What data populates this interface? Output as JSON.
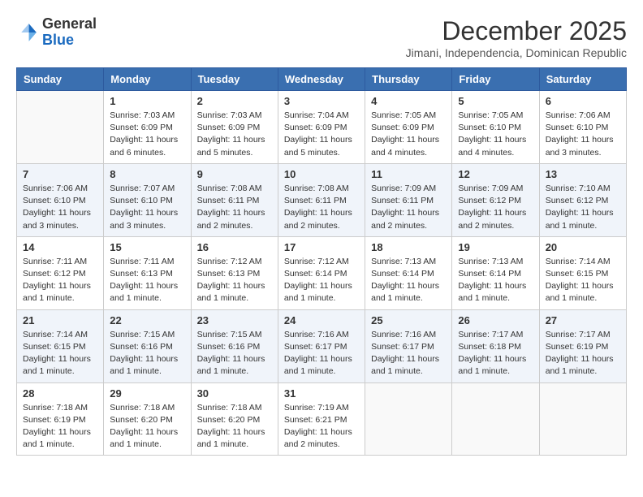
{
  "header": {
    "logo_line1": "General",
    "logo_line2": "Blue",
    "month_title": "December 2025",
    "subtitle": "Jimani, Independencia, Dominican Republic"
  },
  "weekdays": [
    "Sunday",
    "Monday",
    "Tuesday",
    "Wednesday",
    "Thursday",
    "Friday",
    "Saturday"
  ],
  "rows": [
    [
      {
        "day": "",
        "info": ""
      },
      {
        "day": "1",
        "info": "Sunrise: 7:03 AM\nSunset: 6:09 PM\nDaylight: 11 hours\nand 6 minutes."
      },
      {
        "day": "2",
        "info": "Sunrise: 7:03 AM\nSunset: 6:09 PM\nDaylight: 11 hours\nand 5 minutes."
      },
      {
        "day": "3",
        "info": "Sunrise: 7:04 AM\nSunset: 6:09 PM\nDaylight: 11 hours\nand 5 minutes."
      },
      {
        "day": "4",
        "info": "Sunrise: 7:05 AM\nSunset: 6:09 PM\nDaylight: 11 hours\nand 4 minutes."
      },
      {
        "day": "5",
        "info": "Sunrise: 7:05 AM\nSunset: 6:10 PM\nDaylight: 11 hours\nand 4 minutes."
      },
      {
        "day": "6",
        "info": "Sunrise: 7:06 AM\nSunset: 6:10 PM\nDaylight: 11 hours\nand 3 minutes."
      }
    ],
    [
      {
        "day": "7",
        "info": "Sunrise: 7:06 AM\nSunset: 6:10 PM\nDaylight: 11 hours\nand 3 minutes."
      },
      {
        "day": "8",
        "info": "Sunrise: 7:07 AM\nSunset: 6:10 PM\nDaylight: 11 hours\nand 3 minutes."
      },
      {
        "day": "9",
        "info": "Sunrise: 7:08 AM\nSunset: 6:11 PM\nDaylight: 11 hours\nand 2 minutes."
      },
      {
        "day": "10",
        "info": "Sunrise: 7:08 AM\nSunset: 6:11 PM\nDaylight: 11 hours\nand 2 minutes."
      },
      {
        "day": "11",
        "info": "Sunrise: 7:09 AM\nSunset: 6:11 PM\nDaylight: 11 hours\nand 2 minutes."
      },
      {
        "day": "12",
        "info": "Sunrise: 7:09 AM\nSunset: 6:12 PM\nDaylight: 11 hours\nand 2 minutes."
      },
      {
        "day": "13",
        "info": "Sunrise: 7:10 AM\nSunset: 6:12 PM\nDaylight: 11 hours\nand 1 minute."
      }
    ],
    [
      {
        "day": "14",
        "info": "Sunrise: 7:11 AM\nSunset: 6:12 PM\nDaylight: 11 hours\nand 1 minute."
      },
      {
        "day": "15",
        "info": "Sunrise: 7:11 AM\nSunset: 6:13 PM\nDaylight: 11 hours\nand 1 minute."
      },
      {
        "day": "16",
        "info": "Sunrise: 7:12 AM\nSunset: 6:13 PM\nDaylight: 11 hours\nand 1 minute."
      },
      {
        "day": "17",
        "info": "Sunrise: 7:12 AM\nSunset: 6:14 PM\nDaylight: 11 hours\nand 1 minute."
      },
      {
        "day": "18",
        "info": "Sunrise: 7:13 AM\nSunset: 6:14 PM\nDaylight: 11 hours\nand 1 minute."
      },
      {
        "day": "19",
        "info": "Sunrise: 7:13 AM\nSunset: 6:14 PM\nDaylight: 11 hours\nand 1 minute."
      },
      {
        "day": "20",
        "info": "Sunrise: 7:14 AM\nSunset: 6:15 PM\nDaylight: 11 hours\nand 1 minute."
      }
    ],
    [
      {
        "day": "21",
        "info": "Sunrise: 7:14 AM\nSunset: 6:15 PM\nDaylight: 11 hours\nand 1 minute."
      },
      {
        "day": "22",
        "info": "Sunrise: 7:15 AM\nSunset: 6:16 PM\nDaylight: 11 hours\nand 1 minute."
      },
      {
        "day": "23",
        "info": "Sunrise: 7:15 AM\nSunset: 6:16 PM\nDaylight: 11 hours\nand 1 minute."
      },
      {
        "day": "24",
        "info": "Sunrise: 7:16 AM\nSunset: 6:17 PM\nDaylight: 11 hours\nand 1 minute."
      },
      {
        "day": "25",
        "info": "Sunrise: 7:16 AM\nSunset: 6:17 PM\nDaylight: 11 hours\nand 1 minute."
      },
      {
        "day": "26",
        "info": "Sunrise: 7:17 AM\nSunset: 6:18 PM\nDaylight: 11 hours\nand 1 minute."
      },
      {
        "day": "27",
        "info": "Sunrise: 7:17 AM\nSunset: 6:19 PM\nDaylight: 11 hours\nand 1 minute."
      }
    ],
    [
      {
        "day": "28",
        "info": "Sunrise: 7:18 AM\nSunset: 6:19 PM\nDaylight: 11 hours\nand 1 minute."
      },
      {
        "day": "29",
        "info": "Sunrise: 7:18 AM\nSunset: 6:20 PM\nDaylight: 11 hours\nand 1 minute."
      },
      {
        "day": "30",
        "info": "Sunrise: 7:18 AM\nSunset: 6:20 PM\nDaylight: 11 hours\nand 1 minute."
      },
      {
        "day": "31",
        "info": "Sunrise: 7:19 AM\nSunset: 6:21 PM\nDaylight: 11 hours\nand 2 minutes."
      },
      {
        "day": "",
        "info": ""
      },
      {
        "day": "",
        "info": ""
      },
      {
        "day": "",
        "info": ""
      }
    ]
  ]
}
